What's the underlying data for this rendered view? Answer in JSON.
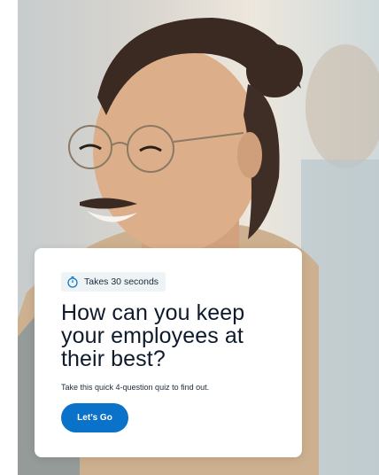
{
  "card": {
    "badge_icon": "stopwatch-icon",
    "badge_text": "Takes 30 seconds",
    "title": "How can you keep your employees at their best?",
    "subtitle": "Take this quick 4-question quiz to find out.",
    "cta_label": "Let’s Go"
  },
  "colors": {
    "accent": "#0a72c8",
    "title": "#0f1a2b",
    "badge_bg": "#eef3f6",
    "card_bg": "#ffffff"
  }
}
